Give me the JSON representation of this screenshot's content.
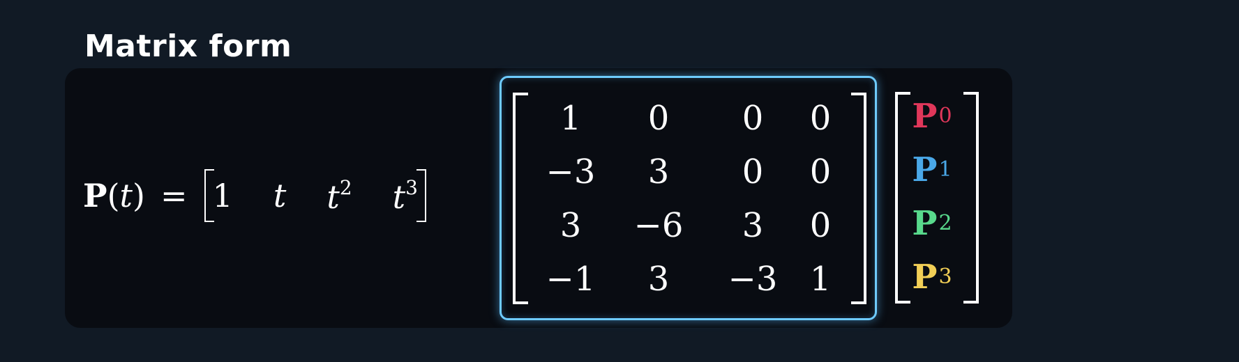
{
  "heading": "Matrix form",
  "lhs": {
    "symbol": "P",
    "variable": "t",
    "equals": "="
  },
  "row_vector": [
    {
      "base": "1",
      "power": ""
    },
    {
      "base": "t",
      "power": ""
    },
    {
      "base": "t",
      "power": "2"
    },
    {
      "base": "t",
      "power": "3"
    }
  ],
  "matrix": [
    [
      "1",
      "0",
      "0",
      "0"
    ],
    [
      "−3",
      "3",
      "0",
      "0"
    ],
    [
      "3",
      "−6",
      "3",
      "0"
    ],
    [
      "−1",
      "3",
      "−3",
      "1"
    ]
  ],
  "point_vector": [
    {
      "symbol": "P",
      "index": "0",
      "color": "#e0375a"
    },
    {
      "symbol": "P",
      "index": "1",
      "color": "#4aa8e8"
    },
    {
      "symbol": "P",
      "index": "2",
      "color": "#58d98c"
    },
    {
      "symbol": "P",
      "index": "3",
      "color": "#f2cf56"
    }
  ],
  "colors": {
    "background": "#111a25",
    "panel": "#090c12",
    "highlight": "#6ecbff",
    "text": "#ffffff"
  }
}
